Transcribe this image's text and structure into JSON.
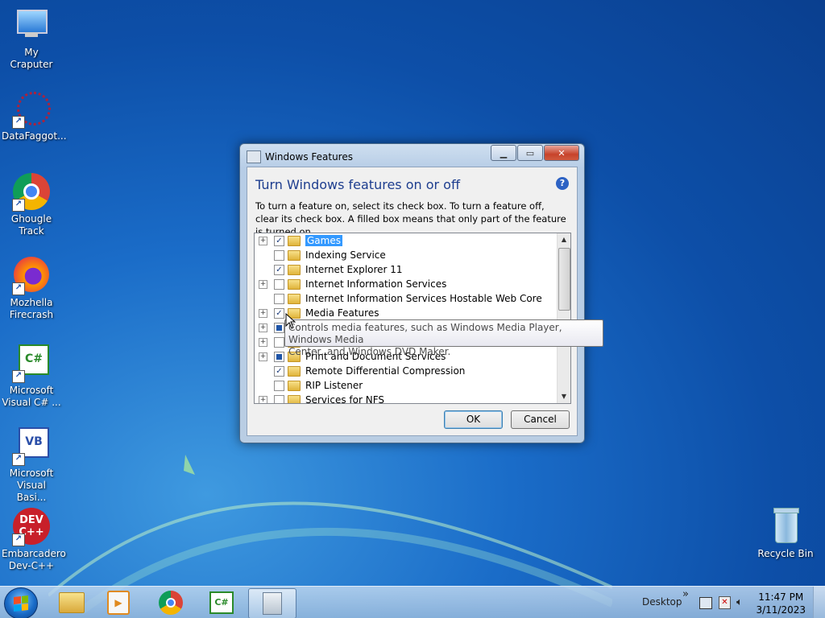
{
  "desktop": {
    "icons": [
      {
        "label_line1": "My Craputer",
        "label_line2": ""
      },
      {
        "label_line1": "DataFaggot...",
        "label_line2": ""
      },
      {
        "label_line1": "Ghougle",
        "label_line2": "Track"
      },
      {
        "label_line1": "Mozhella",
        "label_line2": "Firecrash"
      },
      {
        "label_line1": "Microsoft",
        "label_line2": "Visual C# ..."
      },
      {
        "label_line1": "Microsoft",
        "label_line2": "Visual Basi..."
      },
      {
        "label_line1": "Embarcadero",
        "label_line2": "Dev-C++"
      }
    ],
    "recycle_bin": "Recycle Bin"
  },
  "window": {
    "title": "Windows Features",
    "heading": "Turn Windows features on or off",
    "help_glyph": "?",
    "description": "To turn a feature on, select its check box. To turn a feature off, clear its check box. A filled box means that only part of the feature is turned on.",
    "features": [
      {
        "label": "Games",
        "state": "checked",
        "expandable": true,
        "selected": true
      },
      {
        "label": "Indexing Service",
        "state": "unchecked",
        "expandable": false
      },
      {
        "label": "Internet Explorer 11",
        "state": "checked",
        "expandable": false
      },
      {
        "label": "Internet Information Services",
        "state": "unchecked",
        "expandable": true
      },
      {
        "label": "Internet Information Services Hostable Web Core",
        "state": "unchecked",
        "expandable": false
      },
      {
        "label": "Media Features",
        "state": "checked",
        "expandable": true
      },
      {
        "label": "",
        "state": "partial",
        "expandable": true
      },
      {
        "label": "",
        "state": "unchecked",
        "expandable": true
      },
      {
        "label": "Print and Document Services",
        "state": "partial",
        "expandable": true
      },
      {
        "label": "Remote Differential Compression",
        "state": "checked",
        "expandable": false
      },
      {
        "label": "RIP Listener",
        "state": "unchecked",
        "expandable": false
      },
      {
        "label": "Services for NFS",
        "state": "unchecked",
        "expandable": true
      }
    ],
    "tooltip_line1": "Controls media features, such as Windows Media Player, Windows Media",
    "tooltip_line2": "Center, and Windows DVD Maker.",
    "ok_label": "OK",
    "cancel_label": "Cancel"
  },
  "taskbar": {
    "desktop_label": "Desktop",
    "chevron": "»",
    "time": "11:47 PM",
    "date": "3/11/2023"
  },
  "colors": {
    "selection": "#3399ff",
    "heading": "#1e3e8f"
  }
}
